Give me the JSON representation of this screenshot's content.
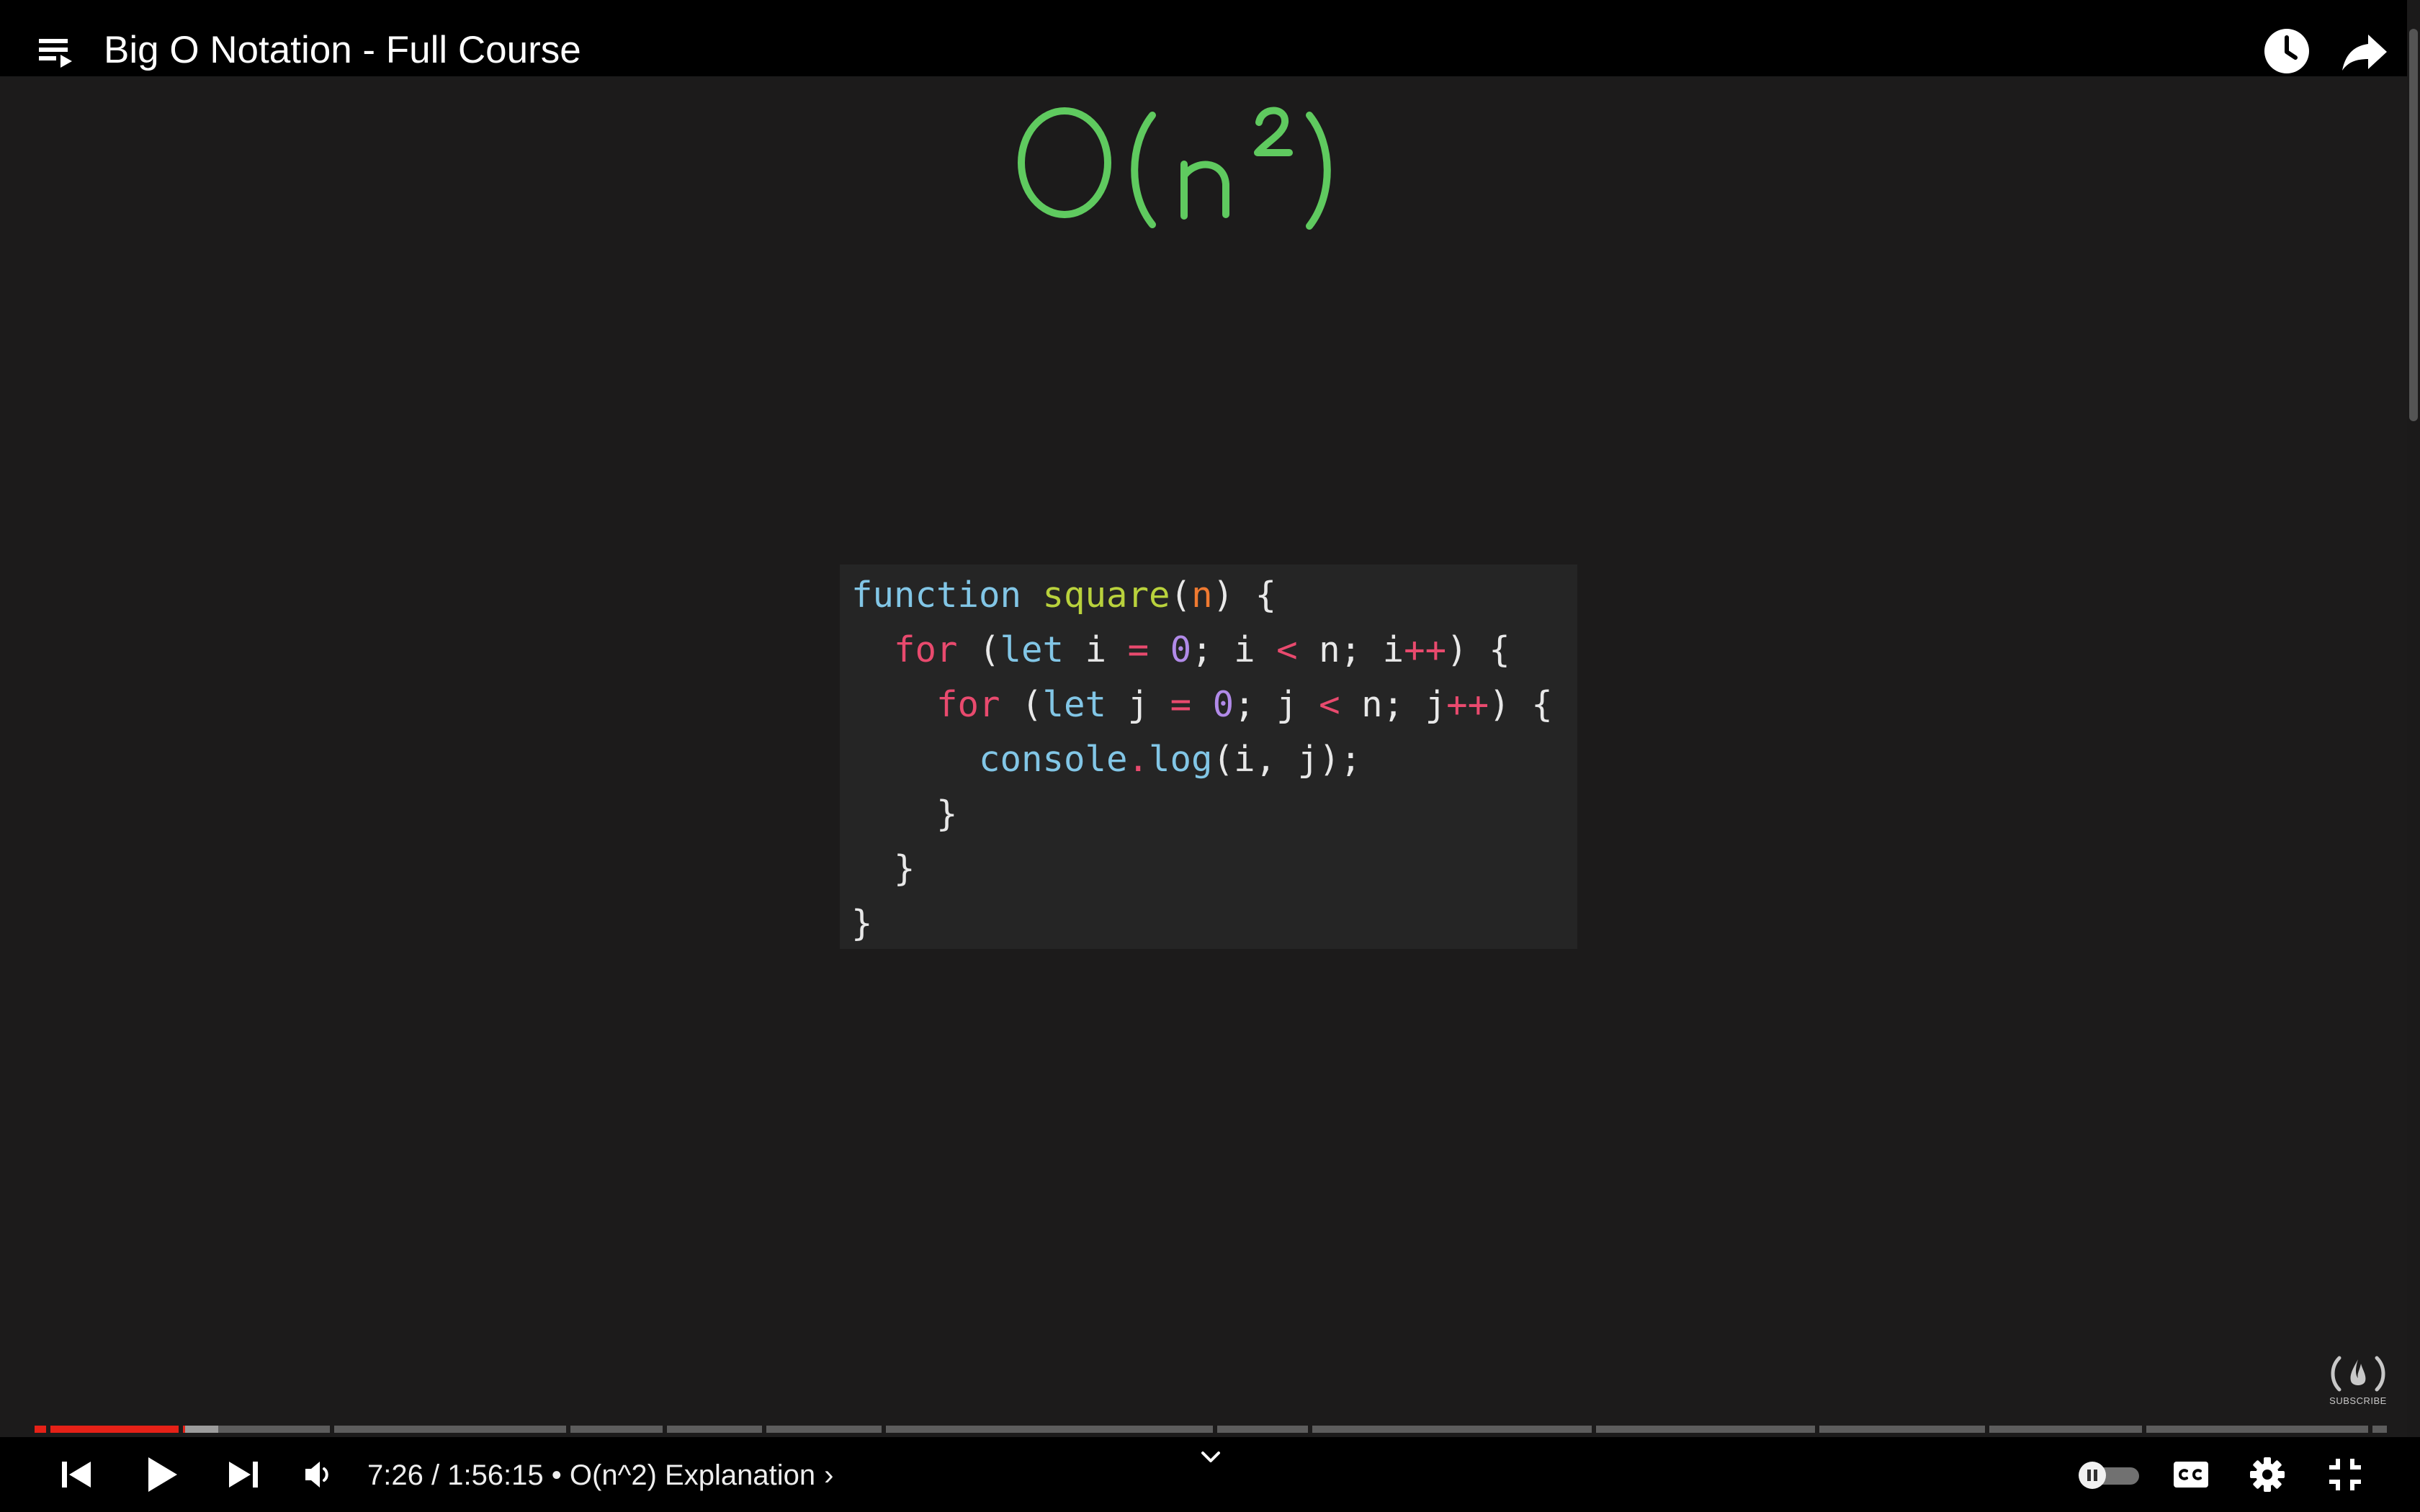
{
  "header": {
    "title": "Big O Notation - Full Course"
  },
  "content": {
    "formula": "O(n²)",
    "code_lines": [
      [
        {
          "t": "function",
          "c": "tok-kw"
        },
        {
          "t": " ",
          "c": ""
        },
        {
          "t": "square",
          "c": "tok-fn"
        },
        {
          "t": "(",
          "c": ""
        },
        {
          "t": "n",
          "c": "tok-param"
        },
        {
          "t": ") {",
          "c": ""
        }
      ],
      [
        {
          "t": "  ",
          "c": ""
        },
        {
          "t": "for",
          "c": "tok-ctrl"
        },
        {
          "t": " (",
          "c": ""
        },
        {
          "t": "let",
          "c": "tok-kw"
        },
        {
          "t": " i ",
          "c": ""
        },
        {
          "t": "=",
          "c": "tok-op"
        },
        {
          "t": " ",
          "c": ""
        },
        {
          "t": "0",
          "c": "tok-num"
        },
        {
          "t": "; i ",
          "c": ""
        },
        {
          "t": "<",
          "c": "tok-op"
        },
        {
          "t": " n; i",
          "c": ""
        },
        {
          "t": "++",
          "c": "tok-op"
        },
        {
          "t": ") {",
          "c": ""
        }
      ],
      [
        {
          "t": "    ",
          "c": ""
        },
        {
          "t": "for",
          "c": "tok-ctrl"
        },
        {
          "t": " (",
          "c": ""
        },
        {
          "t": "let",
          "c": "tok-kw"
        },
        {
          "t": " j ",
          "c": ""
        },
        {
          "t": "=",
          "c": "tok-op"
        },
        {
          "t": " ",
          "c": ""
        },
        {
          "t": "0",
          "c": "tok-num"
        },
        {
          "t": "; j ",
          "c": ""
        },
        {
          "t": "<",
          "c": "tok-op"
        },
        {
          "t": " n; j",
          "c": ""
        },
        {
          "t": "++",
          "c": "tok-op"
        },
        {
          "t": ") {",
          "c": ""
        }
      ],
      [
        {
          "t": "      ",
          "c": ""
        },
        {
          "t": "console",
          "c": "tok-obj"
        },
        {
          "t": ".",
          "c": "tok-dot"
        },
        {
          "t": "log",
          "c": "tok-obj"
        },
        {
          "t": "(i, j);",
          "c": ""
        }
      ],
      [
        {
          "t": "    }",
          "c": ""
        }
      ],
      [
        {
          "t": "  }",
          "c": ""
        }
      ],
      [
        {
          "t": "}",
          "c": ""
        }
      ]
    ]
  },
  "watermark": {
    "label": "SUBSCRIBE"
  },
  "player": {
    "current_time": "7:26",
    "separator": " / ",
    "duration": "1:56:15",
    "chapter_dot": " • ",
    "chapter_title": "O(n^2) Explanation",
    "chapter_arrow": "›",
    "progress_fraction": 0.064,
    "buffered_fraction": 0.078,
    "autoplay": true,
    "colors": {
      "played": "#e62117",
      "formula": "#5fca5f"
    },
    "icons": [
      "playlist-icon",
      "clock-icon",
      "share-icon",
      "previous-icon",
      "play-icon",
      "next-icon",
      "volume-icon",
      "chevron-down-icon",
      "pause-icon",
      "cc-icon",
      "gear-icon",
      "exit-fullscreen-icon",
      "freecodecamp-logo-icon"
    ]
  }
}
